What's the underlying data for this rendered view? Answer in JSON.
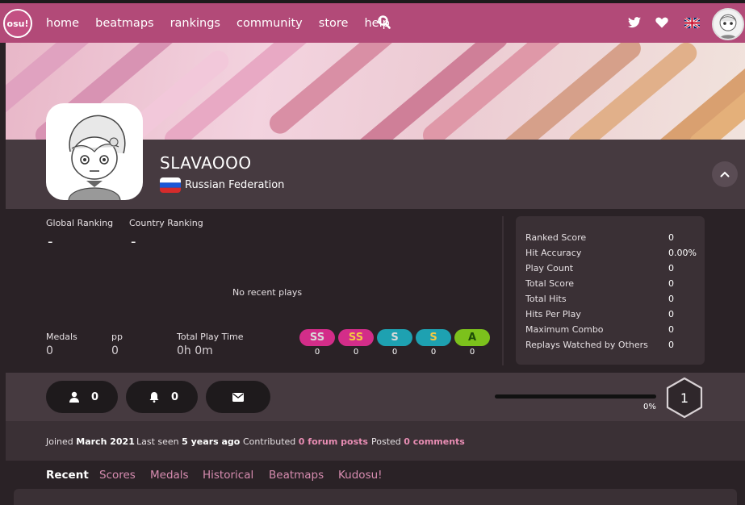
{
  "nav": {
    "logo": "osu!",
    "links": [
      "home",
      "beatmaps",
      "rankings",
      "community",
      "store",
      "help"
    ]
  },
  "profile": {
    "username": "SLAVAOOO",
    "country": "Russian Federation"
  },
  "rank": {
    "global_label": "Global Ranking",
    "global_value": "-",
    "country_label": "Country Ranking",
    "country_value": "-"
  },
  "recent": {
    "empty_text": "No recent plays"
  },
  "summary": {
    "medals_label": "Medals",
    "medals_value": "0",
    "pp_label": "pp",
    "pp_value": "0",
    "playtime_label": "Total Play Time",
    "playtime_value": "0h 0m"
  },
  "grades": [
    {
      "label": "SS",
      "count": "0",
      "bg": "#d32d89",
      "fg": "#d9d9d9"
    },
    {
      "label": "SS",
      "count": "0",
      "bg": "#d32d89",
      "fg": "#f5c842"
    },
    {
      "label": "S",
      "count": "0",
      "bg": "#1ea1b1",
      "fg": "#d9d9d9"
    },
    {
      "label": "S",
      "count": "0",
      "bg": "#1ea1b1",
      "fg": "#f5c842"
    },
    {
      "label": "A",
      "count": "0",
      "bg": "#7cc11c",
      "fg": "#1e4d07"
    }
  ],
  "stats": [
    {
      "label": "Ranked Score",
      "value": "0"
    },
    {
      "label": "Hit Accuracy",
      "value": "0.00%"
    },
    {
      "label": "Play Count",
      "value": "0"
    },
    {
      "label": "Total Score",
      "value": "0"
    },
    {
      "label": "Total Hits",
      "value": "0"
    },
    {
      "label": "Hits Per Play",
      "value": "0"
    },
    {
      "label": "Maximum Combo",
      "value": "0"
    },
    {
      "label": "Replays Watched by Others",
      "value": "0"
    }
  ],
  "social": {
    "followers": "0",
    "mapping_subscribers": "0"
  },
  "level": {
    "progress_percent": 0,
    "progress_label": "0%",
    "value": "1"
  },
  "info": {
    "joined_prefix": "Joined",
    "joined_value": "March 2021",
    "lastseen_prefix": "Last seen",
    "lastseen_value": "5 years ago",
    "contributed_prefix": "Contributed",
    "forum_posts": "0 forum posts",
    "posted_prefix": "Posted",
    "comments": "0 comments"
  },
  "tabs": [
    "Recent",
    "Scores",
    "Medals",
    "Historical",
    "Beatmaps",
    "Kudosu!"
  ],
  "colors": {
    "nav": "#b24a78",
    "accent": "#e98db4"
  }
}
